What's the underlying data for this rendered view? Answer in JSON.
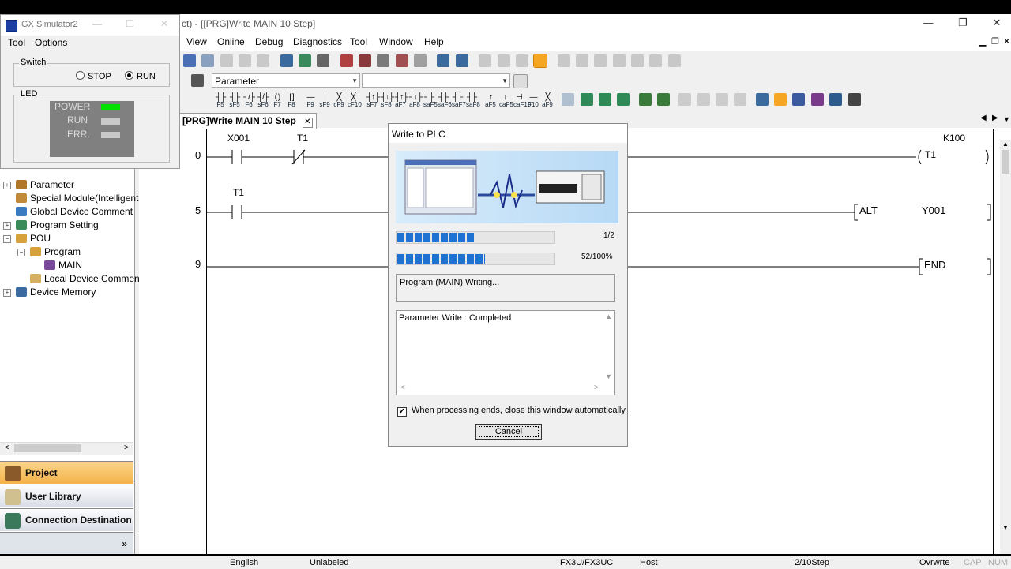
{
  "app": {
    "title": "ct) - [[PRG]Write MAIN 10 Step]",
    "controls": {
      "minimize": "—",
      "restore": "❐",
      "close": "✕"
    },
    "mdi_controls": {
      "minimize": "▁",
      "restore": "❐",
      "close": "✕"
    },
    "menu": [
      "View",
      "Online",
      "Debug",
      "Diagnostics",
      "Tool",
      "Window",
      "Help"
    ],
    "parameter_combo": "Parameter",
    "fkeys": [
      {
        "top": "F5",
        "glyph": "┤├"
      },
      {
        "top": "sF5",
        "glyph": "┤├"
      },
      {
        "top": "F6",
        "glyph": "┤/├"
      },
      {
        "top": "sF6",
        "glyph": "┤/├"
      },
      {
        "top": "F7",
        "glyph": "( )"
      },
      {
        "top": "F8",
        "glyph": "[ ]"
      },
      {
        "top": "F9",
        "glyph": "—"
      },
      {
        "top": "sF9",
        "glyph": "|"
      },
      {
        "top": "cF9",
        "glyph": "╳"
      },
      {
        "top": "cF10",
        "glyph": "╳"
      },
      {
        "top": "sF7",
        "glyph": "┤↑├"
      },
      {
        "top": "sF8",
        "glyph": "┤↓├"
      },
      {
        "top": "aF7",
        "glyph": "┤↑├"
      },
      {
        "top": "aF8",
        "glyph": "┤↓├"
      },
      {
        "top": "saF5",
        "glyph": "┤├"
      },
      {
        "top": "saF6",
        "glyph": "┤├"
      },
      {
        "top": "saF7",
        "glyph": "┤├"
      },
      {
        "top": "saF8",
        "glyph": "┤├"
      },
      {
        "top": "aF5",
        "glyph": "↑"
      },
      {
        "top": "caF5",
        "glyph": "↓"
      },
      {
        "top": "caF10",
        "glyph": "⊣"
      },
      {
        "top": "F10",
        "glyph": "—"
      },
      {
        "top": "aF9",
        "glyph": "╳"
      }
    ]
  },
  "simulator": {
    "title": "GX Simulator2",
    "menu": [
      "Tool",
      "Options"
    ],
    "switch_label": "Switch",
    "stop_label": "STOP",
    "run_label": "RUN",
    "selected": "RUN",
    "led_label": "LED",
    "leds": [
      {
        "label": "POWER",
        "color": "#00e000"
      },
      {
        "label": "RUN",
        "color": "#c8c8c8"
      },
      {
        "label": "ERR.",
        "color": "#c8c8c8"
      }
    ]
  },
  "tree": [
    {
      "label": "Parameter",
      "expander": "+"
    },
    {
      "label": "Special Module(Intelligent",
      "expander": ""
    },
    {
      "label": "Global Device Comment",
      "expander": ""
    },
    {
      "label": "Program Setting",
      "expander": "+"
    },
    {
      "label": "POU",
      "expander": "−"
    },
    {
      "label": "Program",
      "expander": "−"
    },
    {
      "label": "MAIN",
      "expander": ""
    },
    {
      "label": "Local Device Commen",
      "expander": ""
    },
    {
      "label": "Device Memory",
      "expander": "+"
    }
  ],
  "nav_buttons": [
    "Project",
    "User Library",
    "Connection Destination"
  ],
  "nav_more": "»",
  "editor": {
    "tab_label": "[PRG]Write MAIN 10 Step",
    "tab_close": "✕",
    "rungs": [
      {
        "step": "0",
        "contacts": [
          "X001",
          "T1"
        ],
        "coil": "T1",
        "coil_param": "K100"
      },
      {
        "step": "5",
        "contacts": [
          "T1"
        ],
        "instr": "ALT",
        "operand": "Y001"
      },
      {
        "step": "9",
        "instr": "END"
      }
    ]
  },
  "dialog": {
    "title": "Write to PLC",
    "progress1": {
      "label": "1/2",
      "fraction": 0.5
    },
    "progress2": {
      "label": "52/100%",
      "fraction": 0.56
    },
    "status_text": "Program (MAIN) Writing...",
    "log_text": "Parameter Write : Completed",
    "auto_close_label": "When processing ends, close this window automatically.",
    "auto_close_checked": "✔",
    "cancel_label": "Cancel"
  },
  "statusbar": [
    "English",
    "Unlabeled",
    "FX3U/FX3UC",
    "Host",
    "2/10Step",
    "Ovrwrte"
  ],
  "statusbar_dim": [
    "CAP",
    "NUM"
  ]
}
